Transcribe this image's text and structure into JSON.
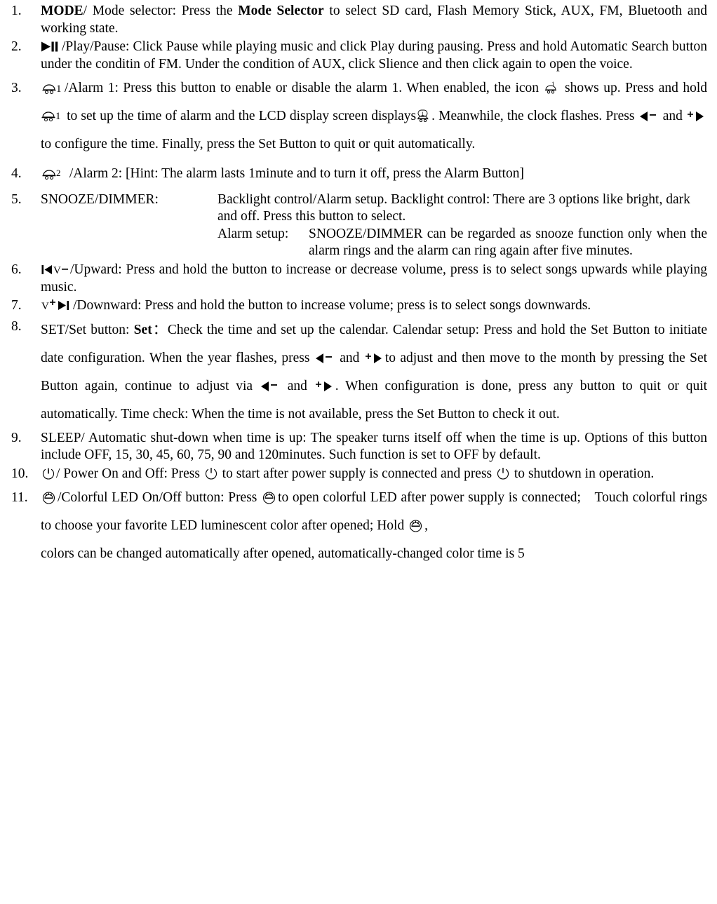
{
  "document": {
    "items": [
      {
        "number": "1.",
        "type": "plain",
        "segments": [
          {
            "t": "text",
            "v": "MODE",
            "bold": true
          },
          {
            "t": "text",
            "v": "/ Mode selector: Press the "
          },
          {
            "t": "text",
            "v": "Mode Selector",
            "bold": true
          },
          {
            "t": "text",
            "v": " to select SD card, Flash Memory Stick, AUX, FM, Bluetooth and working state."
          }
        ],
        "text": "MODE/ Mode selector: Press the Mode Selector to select SD card, Flash Memory Stick, AUX, FM, Bluetooth and working state."
      },
      {
        "number": "2.",
        "type": "plain",
        "text": "/Play/Pause: Click Pause while playing music and click Play during pausing. Press and hold Automatic Search button under the conditin of FM. Under the condition of AUX, click Slience and then click again to open the voice.",
        "lead_icon": "play-pause-icon"
      },
      {
        "number": "3.",
        "type": "alarm1",
        "text": "/Alarm 1: Press this button to enable or disable the alarm 1. When enabled, the icon shows up. Press and hold to set up the time of alarm and the LCD display screen displays . Meanwhile, the clock flashes. Press and to configure the time. Finally, press the Set Button to quit or quit automatically.",
        "parts": {
          "p1": "/Alarm 1: Press this button to enable or disable the alarm 1. When enabled, the icon",
          "p2": "shows up. Press and hold",
          "p3": "to set up the time of alarm and the LCD display screen",
          "p4": "displays",
          "p5": ". Meanwhile, the clock flashes. Press",
          "p6": "and",
          "p7": "to configure the time. Finally,",
          "p8": "press the Set Button to quit or quit automatically."
        }
      },
      {
        "number": "4.",
        "type": "alarm2",
        "text": "/Alarm 2: [Hint: The alarm lasts 1minute and to turn it off, press the Alarm Button]"
      },
      {
        "number": "5.",
        "type": "snooze",
        "label": "SNOOZE/DIMMER:",
        "backlight_text": "Backlight control/Alarm setup. Backlight control: There are 3 options like bright, dark and off. Press this button to select.",
        "alarm_setup_label": "Alarm setup:",
        "alarm_setup_text": "SNOOZE/DIMMER can be regarded as snooze function only when the alarm rings and the alarm can ring again after five minutes."
      },
      {
        "number": "6.",
        "type": "upward",
        "text": "/Upward: Press and hold the button to increase or decrease volume, press is to select songs upwards while playing music."
      },
      {
        "number": "7.",
        "type": "downward",
        "text": "/Downward: Press and hold the button to increase volume; press is to select songs downwards."
      },
      {
        "number": "8.",
        "type": "set",
        "parts": {
          "p1": "SET/Set button: ",
          "p1b": "Set",
          "p1c": "：",
          "p2": "Check the time and set up the calendar. Calendar setup: Press and hold the",
          "p3": "Set Button to initiate date configuration. When the year flashes, press",
          "p4": "and",
          "p5": "to adjust and",
          "p6": "then move to the month by pressing the Set Button again, continue to adjust via",
          "p7": "and",
          "p8": ".",
          "p9": "When configuration is done, press any button to quit or quit automatically. Time check: When the time is not available, press the Set Button to check it out."
        }
      },
      {
        "number": "9.",
        "type": "plain",
        "text": "SLEEP/ Automatic shut-down when time is up: The speaker turns itself off when the time is up. Options of this button include OFF, 15, 30, 45, 60, 75, 90 and 120minutes. Such function is set to OFF by default."
      },
      {
        "number": "10.",
        "type": "power",
        "parts": {
          "p1": "/ Power On and Off: Press",
          "p2": "to start after power supply is connected and press",
          "p3": "to",
          "p4": "shutdown in operation."
        }
      },
      {
        "number": "11.",
        "type": "led",
        "parts": {
          "p1": "/Colorful LED On/Off button: Press",
          "p2": "to open colorful LED after power supply is connected;",
          "p3": "Touch colorful rings to choose your favorite LED luminescent color after opened; Hold",
          "p4": ",",
          "p5": "colors can be changed automatically after opened, automatically-changed color time is 5"
        }
      }
    ]
  },
  "icons": {
    "play_pause": "play-pause-icon",
    "alarm_bell_1": "alarm-bell-1-icon",
    "alarm_bell_2": "alarm-bell-2-icon",
    "alarm_display": "alarm-display-icon",
    "prev_minus": "prev-minus-icon",
    "next_plus": "next-plus-icon",
    "vol_down": "volume-down-icon",
    "vol_up": "volume-up-icon",
    "power": "power-icon",
    "led": "colorful-led-icon"
  }
}
